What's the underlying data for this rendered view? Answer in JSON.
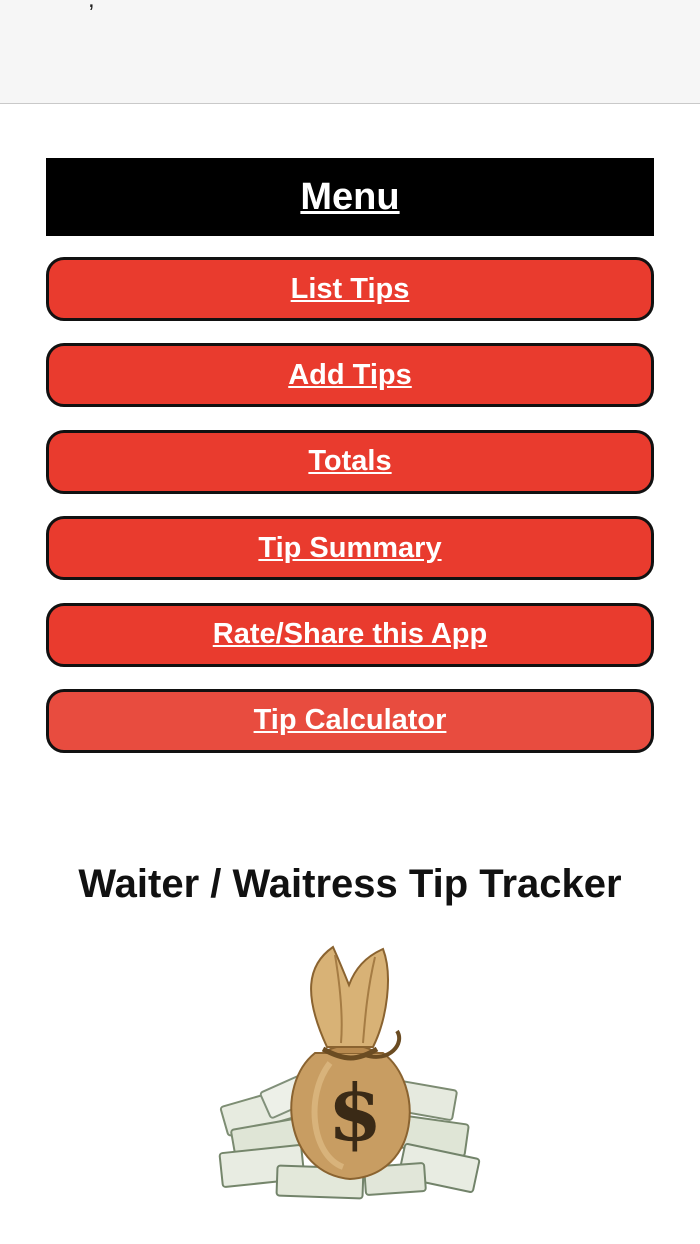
{
  "topbar": {
    "fragment": ","
  },
  "menu": {
    "header": "Menu",
    "items": [
      {
        "label": "List Tips"
      },
      {
        "label": "Add Tips"
      },
      {
        "label": "Totals"
      },
      {
        "label": "Tip Summary"
      },
      {
        "label": "Rate/Share this App"
      },
      {
        "label": "Tip Calculator"
      }
    ]
  },
  "app": {
    "title": "Waiter / Waitress Tip Tracker"
  },
  "image": {
    "dollar_sign": "$"
  },
  "colors": {
    "menu_button": "#e93b2e",
    "menu_header": "#000000",
    "topbar": "#f6f6f6"
  }
}
